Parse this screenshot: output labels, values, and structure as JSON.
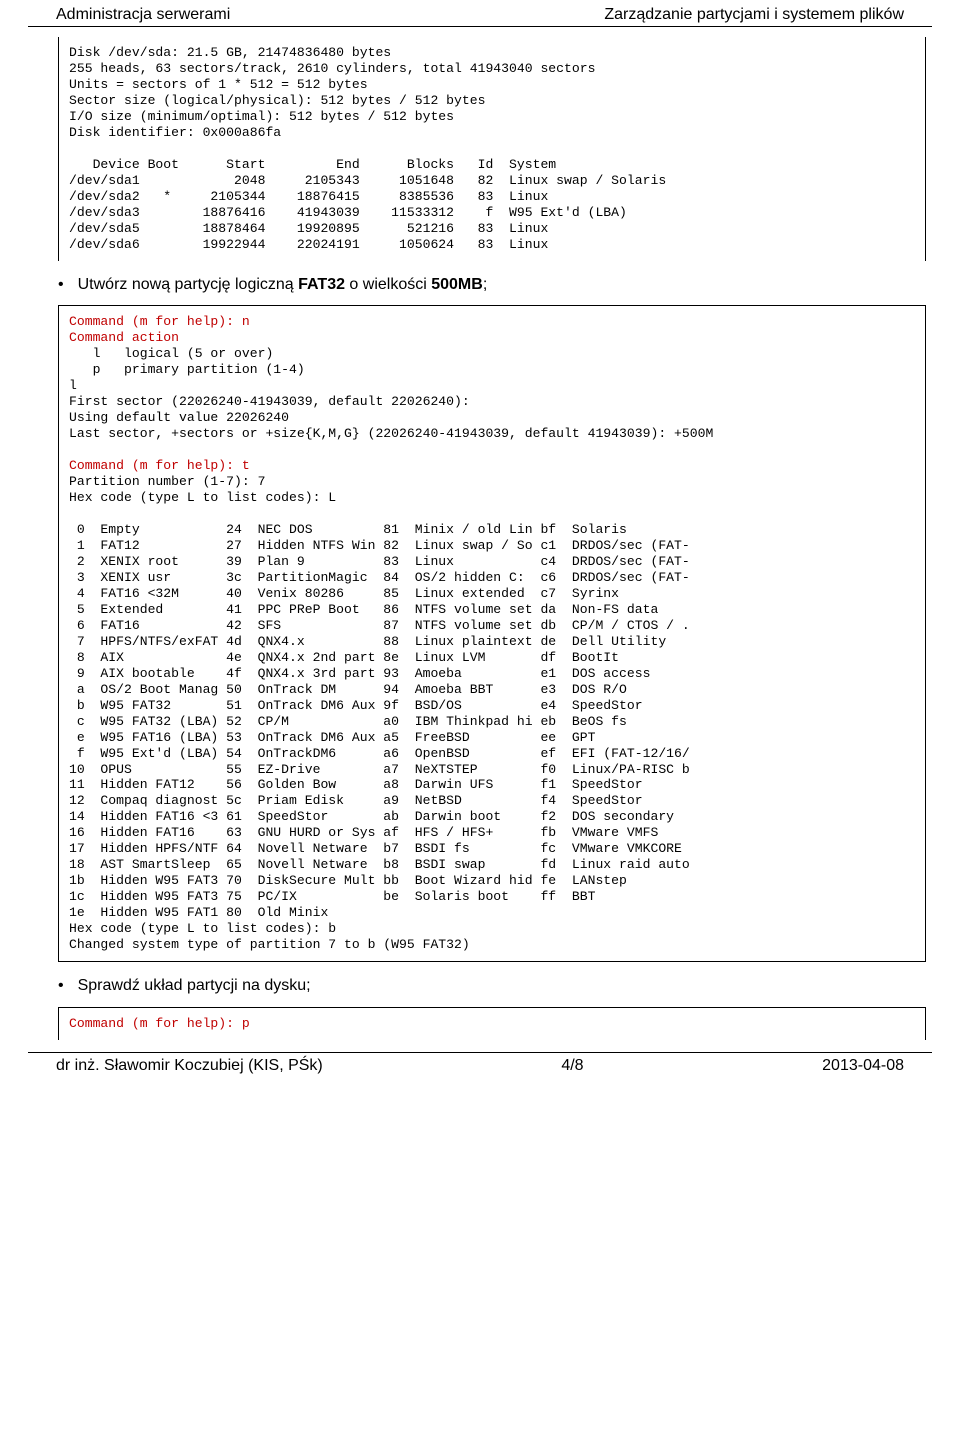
{
  "header": {
    "left": "Administracja serwerami",
    "right": "Zarządzanie partycjami i systemem plików"
  },
  "footer": {
    "left": "dr inż. Sławomir Koczubiej (KIS, PŚk)",
    "center": "4/8",
    "right": "2013-04-08"
  },
  "bullets": {
    "b1_pre": "Utwórz nową partycję logiczną ",
    "b1_bold1": "FAT32",
    "b1_mid": " o wielkości ",
    "b1_bold2": "500MB",
    "b1_post": ";",
    "b2": "Sprawdź układ partycji na dysku;"
  },
  "block1": "Disk /dev/sda: 21.5 GB, 21474836480 bytes\n255 heads, 63 sectors/track, 2610 cylinders, total 41943040 sectors\nUnits = sectors of 1 * 512 = 512 bytes\nSector size (logical/physical): 512 bytes / 512 bytes\nI/O size (minimum/optimal): 512 bytes / 512 bytes\nDisk identifier: 0x000a86fa\n\n   Device Boot      Start         End      Blocks   Id  System\n/dev/sda1            2048     2105343     1051648   82  Linux swap / Solaris\n/dev/sda2   *     2105344    18876415     8385536   83  Linux\n/dev/sda3        18876416    41943039    11533312    f  W95 Ext'd (LBA)\n/dev/sda5        18878464    19920895      521216   83  Linux\n/dev/sda6        19922944    22024191     1050624   83  Linux",
  "block2": {
    "r1": "Command (m for help): n",
    "r2": "Command action",
    "p1": "   l   logical (5 or over)\n   p   primary partition (1-4)\nl\nFirst sector (22026240-41943039, default 22026240):\nUsing default value 22026240\nLast sector, +sectors or +size{K,M,G} (22026240-41943039, default 41943039): +500M\n",
    "r3": "Command (m for help): t",
    "p2": "Partition number (1-7): 7\nHex code (type L to list codes): L\n\n 0  Empty           24  NEC DOS         81  Minix / old Lin bf  Solaris\n 1  FAT12           27  Hidden NTFS Win 82  Linux swap / So c1  DRDOS/sec (FAT-\n 2  XENIX root      39  Plan 9          83  Linux           c4  DRDOS/sec (FAT-\n 3  XENIX usr       3c  PartitionMagic  84  OS/2 hidden C:  c6  DRDOS/sec (FAT-\n 4  FAT16 <32M      40  Venix 80286     85  Linux extended  c7  Syrinx\n 5  Extended        41  PPC PReP Boot   86  NTFS volume set da  Non-FS data\n 6  FAT16           42  SFS             87  NTFS volume set db  CP/M / CTOS / .\n 7  HPFS/NTFS/exFAT 4d  QNX4.x          88  Linux plaintext de  Dell Utility\n 8  AIX             4e  QNX4.x 2nd part 8e  Linux LVM       df  BootIt\n 9  AIX bootable    4f  QNX4.x 3rd part 93  Amoeba          e1  DOS access\n a  OS/2 Boot Manag 50  OnTrack DM      94  Amoeba BBT      e3  DOS R/O\n b  W95 FAT32       51  OnTrack DM6 Aux 9f  BSD/OS          e4  SpeedStor\n c  W95 FAT32 (LBA) 52  CP/M            a0  IBM Thinkpad hi eb  BeOS fs\n e  W95 FAT16 (LBA) 53  OnTrack DM6 Aux a5  FreeBSD         ee  GPT\n f  W95 Ext'd (LBA) 54  OnTrackDM6      a6  OpenBSD         ef  EFI (FAT-12/16/\n10  OPUS            55  EZ-Drive        a7  NeXTSTEP        f0  Linux/PA-RISC b\n11  Hidden FAT12    56  Golden Bow      a8  Darwin UFS      f1  SpeedStor\n12  Compaq diagnost 5c  Priam Edisk     a9  NetBSD          f4  SpeedStor\n14  Hidden FAT16 <3 61  SpeedStor       ab  Darwin boot     f2  DOS secondary\n16  Hidden FAT16    63  GNU HURD or Sys af  HFS / HFS+      fb  VMware VMFS\n17  Hidden HPFS/NTF 64  Novell Netware  b7  BSDI fs         fc  VMware VMKCORE\n18  AST SmartSleep  65  Novell Netware  b8  BSDI swap       fd  Linux raid auto\n1b  Hidden W95 FAT3 70  DiskSecure Mult bb  Boot Wizard hid fe  LANstep\n1c  Hidden W95 FAT3 75  PC/IX           be  Solaris boot    ff  BBT\n1e  Hidden W95 FAT1 80  Old Minix\nHex code (type L to list codes): b\nChanged system type of partition 7 to b (W95 FAT32)"
  },
  "block3": {
    "r1": "Command (m for help): p"
  }
}
